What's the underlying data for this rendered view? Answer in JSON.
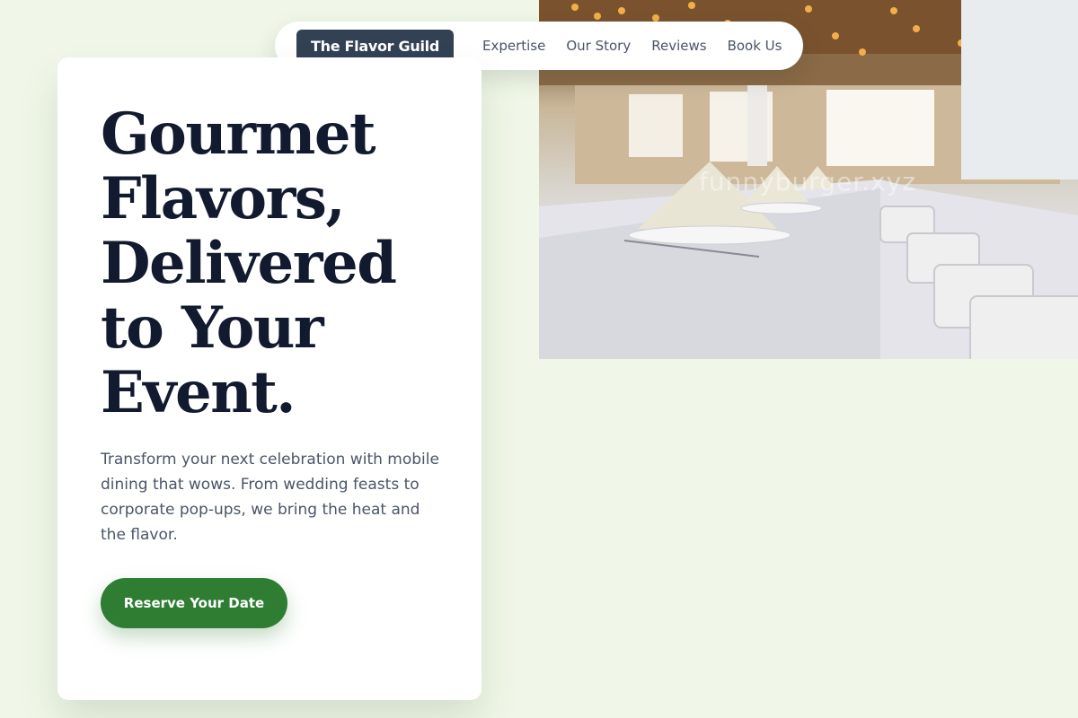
{
  "nav": {
    "brand": "The Flavor Guild",
    "links": [
      "Expertise",
      "Our Story",
      "Reviews",
      "Book Us"
    ]
  },
  "hero": {
    "headline_lines": [
      "Gourmet",
      "Flavors,",
      "Delivered",
      "to Your",
      "Event."
    ],
    "description": "Transform your next celebration with mobile dining that wows. From wedding feasts to corporate pop-ups, we bring the heat and the flavor.",
    "cta_label": "Reserve Your Date"
  },
  "photo": {
    "watermark": "funnyburger.xyz",
    "subject": "banquet-hall-table-setting"
  },
  "colors": {
    "page_bg": "#f0f7e8",
    "brand_bg": "#334155",
    "accent": "#2e7d32",
    "headline": "#111a2e",
    "body_text": "#4a5568"
  }
}
